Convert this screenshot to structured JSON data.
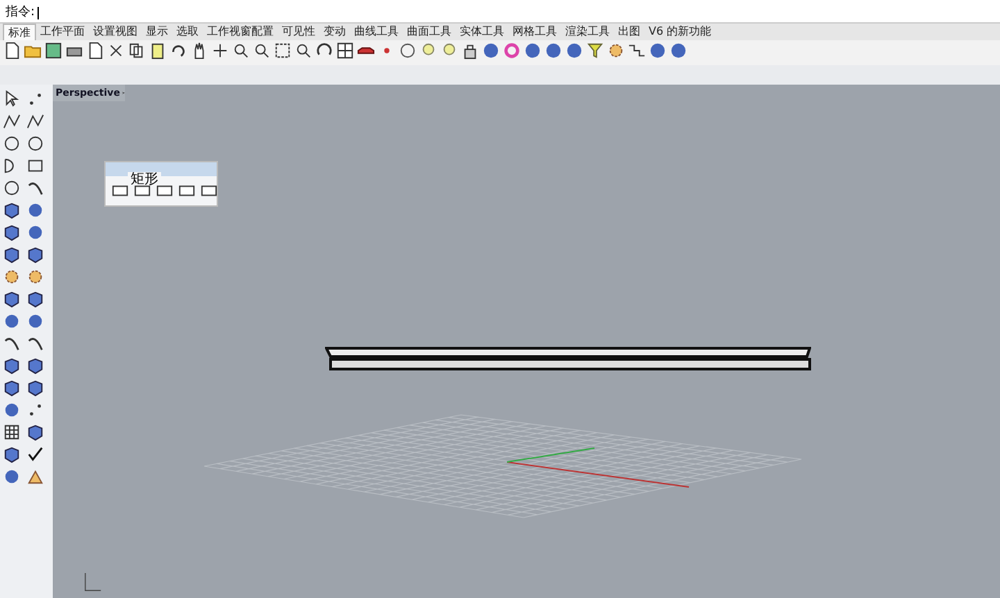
{
  "command_bar": {
    "prompt": "指令:"
  },
  "tabs": [
    {
      "label": "标准",
      "selected": true
    },
    {
      "label": "工作平面",
      "selected": false
    },
    {
      "label": "设置视图",
      "selected": false
    },
    {
      "label": "显示",
      "selected": false
    },
    {
      "label": "选取",
      "selected": false
    },
    {
      "label": "工作视窗配置",
      "selected": false
    },
    {
      "label": "可见性",
      "selected": false
    },
    {
      "label": "变动",
      "selected": false
    },
    {
      "label": "曲线工具",
      "selected": false
    },
    {
      "label": "曲面工具",
      "selected": false
    },
    {
      "label": "实体工具",
      "selected": false
    },
    {
      "label": "网格工具",
      "selected": false
    },
    {
      "label": "渲染工具",
      "selected": false
    },
    {
      "label": "出图",
      "selected": false
    },
    {
      "label": "V6 的新功能",
      "selected": false
    }
  ],
  "viewport": {
    "title": "Perspective"
  },
  "floating_panel": {
    "title": "矩形"
  }
}
